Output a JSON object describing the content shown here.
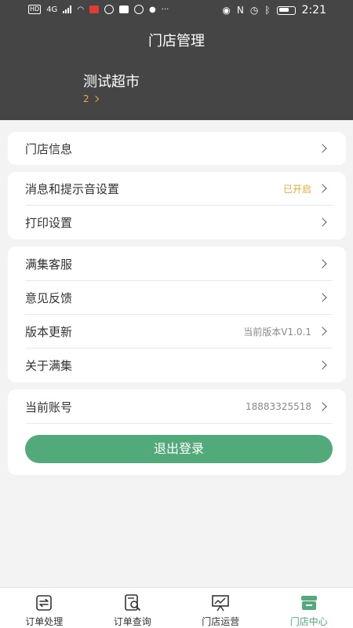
{
  "status_bar": {
    "time": "2:21",
    "left_text": "HD",
    "network": "4G"
  },
  "header": {
    "title": "门店管理",
    "store_name": "测试超市",
    "store_sub": "2"
  },
  "cards": {
    "store_info": {
      "label": "门店信息"
    },
    "settings": [
      {
        "label": "消息和提示音设置",
        "value": "已开启"
      },
      {
        "label": "打印设置",
        "value": ""
      }
    ],
    "support": [
      {
        "label": "满集客服",
        "value": ""
      },
      {
        "label": "意见反馈",
        "value": ""
      },
      {
        "label": "版本更新",
        "value": "当前版本V1.0.1"
      },
      {
        "label": "关于满集",
        "value": ""
      }
    ],
    "account": {
      "label": "当前账号",
      "value": "18883325518",
      "logout_label": "退出登录"
    }
  },
  "tabbar": {
    "tabs": [
      {
        "label": "订单处理",
        "icon": "order-process-icon"
      },
      {
        "label": "订单查询",
        "icon": "order-search-icon"
      },
      {
        "label": "门店运营",
        "icon": "store-operation-icon"
      },
      {
        "label": "门店中心",
        "icon": "store-center-icon"
      }
    ],
    "active_index": 3
  },
  "colors": {
    "header_bg": "#454545",
    "accent_green": "#52a97a",
    "accent_orange": "#e9a93b"
  }
}
